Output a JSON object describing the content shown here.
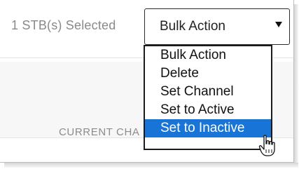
{
  "toolbar": {
    "selected_count_text": "1 STB(s) Selected",
    "bulk_action_select": {
      "value": "Bulk Action"
    }
  },
  "bulk_action_menu": {
    "items": [
      {
        "label": "Bulk Action",
        "highlighted": false
      },
      {
        "label": "Delete",
        "highlighted": false
      },
      {
        "label": "Set Channel",
        "highlighted": false
      },
      {
        "label": "Set to Active",
        "highlighted": false
      },
      {
        "label": "Set to Inactive",
        "highlighted": true
      }
    ]
  },
  "table": {
    "visible_column_header_fragment": "CURRENT CHA"
  },
  "icons": {
    "select_caret": "caret-down-icon",
    "pointer": "hand-pointer-icon"
  },
  "colors": {
    "highlight": "#1874d6",
    "highlight_text": "#ffffff",
    "muted_text": "#8a8a8a"
  }
}
